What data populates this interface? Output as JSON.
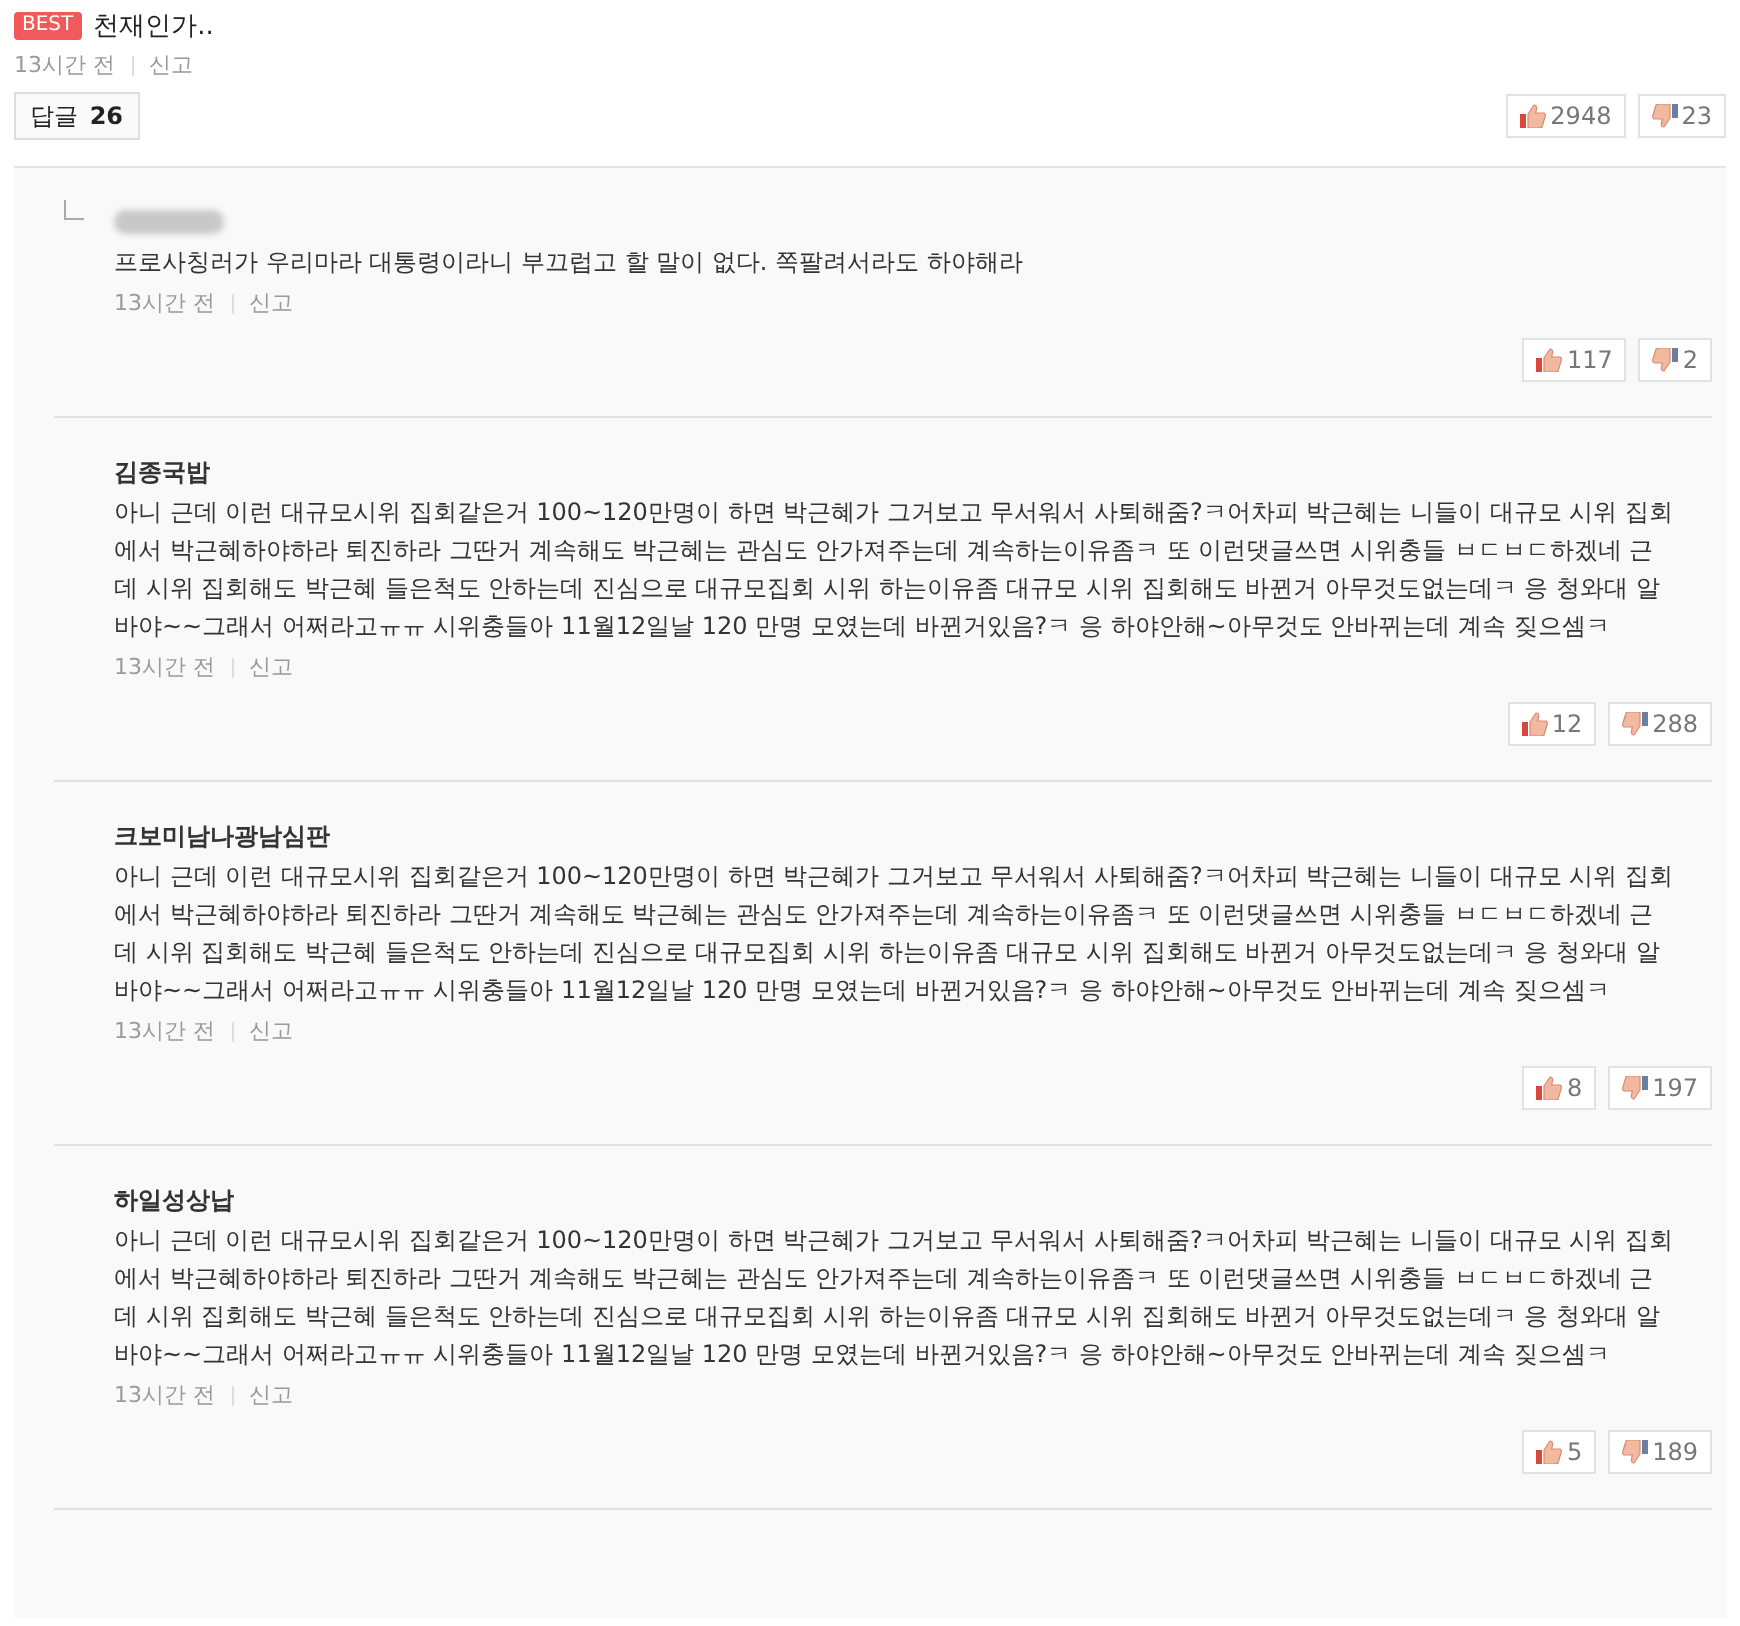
{
  "post": {
    "badge": "BEST",
    "title": "천재인가..",
    "time": "13시간 전",
    "report": "신고",
    "reply_button": {
      "label": "답글",
      "count": "26"
    },
    "likes": "2948",
    "dislikes": "23"
  },
  "replies": [
    {
      "author_hidden": true,
      "indent_mark": true,
      "body": "프로사칭러가 우리마라 대통령이라니 부끄럽고 할 말이 없다. 쪽팔려서라도 하야해라",
      "time": "13시간 전",
      "report": "신고",
      "likes": "117",
      "dislikes": "2"
    },
    {
      "author": "김종국밥",
      "author_hidden": false,
      "indent_mark": false,
      "body": "아니 근데 이런 대규모시위 집회같은거 100~120만명이 하면 박근혜가 그거보고 무서워서 사퇴해줌?ㅋ어차피 박근혜는 니들이 대규모 시위 집회에서 박근혜하야하라 퇴진하라 그딴거 계속해도 박근혜는 관심도 안가져주는데 계속하는이유좀ㅋ 또 이런댓글쓰면 시위충들 ㅂㄷㅂㄷ하겠네 근데 시위 집회해도 박근혜 들은척도 안하는데 진심으로 대규모집회 시위 하는이유좀 대규모 시위 집회해도 바뀐거 아무것도없는데ㅋ 응 청와대 알바야~~그래서 어쩌라고ㅠㅠ 시위충들아 11월12일날 120 만명 모였는데 바뀐거있음?ㅋ 응 하야안해~아무것도 안바뀌는데 계속 짖으셈ㅋ",
      "time": "13시간 전",
      "report": "신고",
      "likes": "12",
      "dislikes": "288"
    },
    {
      "author": "크보미남나광남심판",
      "author_hidden": false,
      "indent_mark": false,
      "body": "아니 근데 이런 대규모시위 집회같은거 100~120만명이 하면 박근혜가 그거보고 무서워서 사퇴해줌?ㅋ어차피 박근혜는 니들이 대규모 시위 집회에서 박근혜하야하라 퇴진하라 그딴거 계속해도 박근혜는 관심도 안가져주는데 계속하는이유좀ㅋ 또 이런댓글쓰면 시위충들 ㅂㄷㅂㄷ하겠네 근데 시위 집회해도 박근혜 들은척도 안하는데 진심으로 대규모집회 시위 하는이유좀 대규모 시위 집회해도 바뀐거 아무것도없는데ㅋ 응 청와대 알바야~~그래서 어쩌라고ㅠㅠ 시위충들아 11월12일날 120 만명 모였는데 바뀐거있음?ㅋ 응 하야안해~아무것도 안바뀌는데 계속 짖으셈ㅋ",
      "time": "13시간 전",
      "report": "신고",
      "likes": "8",
      "dislikes": "197"
    },
    {
      "author": "하일성상납",
      "author_hidden": false,
      "indent_mark": false,
      "body": "아니 근데 이런 대규모시위 집회같은거 100~120만명이 하면 박근혜가 그거보고 무서워서 사퇴해줌?ㅋ어차피 박근혜는 니들이 대규모 시위 집회에서 박근혜하야하라 퇴진하라 그딴거 계속해도 박근혜는 관심도 안가져주는데 계속하는이유좀ㅋ 또 이런댓글쓰면 시위충들 ㅂㄷㅂㄷ하겠네 근데 시위 집회해도 박근혜 들은척도 안하는데 진심으로 대규모집회 시위 하는이유좀 대규모 시위 집회해도 바뀐거 아무것도없는데ㅋ 응 청와대 알바야~~그래서 어쩌라고ㅠㅠ 시위충들아 11월12일날 120 만명 모였는데 바뀐거있음?ㅋ 응 하야안해~아무것도 안바뀌는데 계속 짖으셈ㅋ",
      "time": "13시간 전",
      "report": "신고",
      "likes": "5",
      "dislikes": "189"
    }
  ]
}
